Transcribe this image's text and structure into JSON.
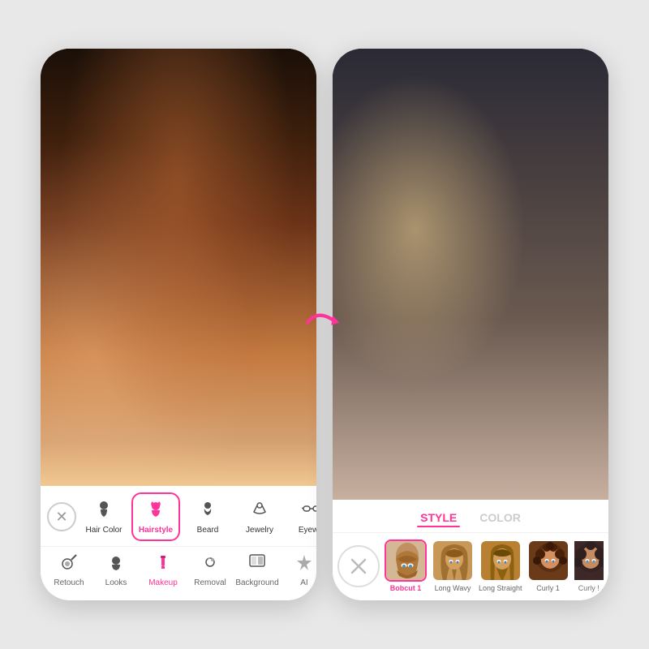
{
  "scene": {
    "background_color": "#e8e8e8"
  },
  "left_phone": {
    "toolbar": {
      "cancel_label": "×",
      "tools": [
        {
          "id": "hair-color",
          "label": "Hair Color",
          "icon": "👤",
          "active": false
        },
        {
          "id": "hairstyle",
          "label": "Hairstyle",
          "icon": "💇",
          "active": true
        },
        {
          "id": "beard",
          "label": "Beard",
          "icon": "🧔",
          "active": false
        },
        {
          "id": "jewelry",
          "label": "Jewelry",
          "icon": "💍",
          "active": false
        },
        {
          "id": "eyewear",
          "label": "Eyew...",
          "icon": "👓",
          "active": false
        }
      ],
      "bottom_tools": [
        {
          "id": "retouch",
          "label": "Retouch",
          "icon": "✨",
          "active": false
        },
        {
          "id": "looks",
          "label": "Looks",
          "icon": "🎨",
          "active": false
        },
        {
          "id": "makeup",
          "label": "Makeup",
          "icon": "💄",
          "active": true
        },
        {
          "id": "removal",
          "label": "Removal",
          "icon": "🔧",
          "active": false
        },
        {
          "id": "background",
          "label": "Background",
          "icon": "🖼",
          "active": false
        },
        {
          "id": "ai",
          "label": "AI",
          "icon": "⭐",
          "active": false
        }
      ]
    }
  },
  "right_phone": {
    "tabs": [
      {
        "id": "style",
        "label": "STYLE",
        "active": true
      },
      {
        "id": "color",
        "label": "COLOR",
        "active": false
      }
    ],
    "hairstyles": [
      {
        "id": "none",
        "label": "",
        "type": "cancel"
      },
      {
        "id": "bobcut1",
        "label": "Bobcut 1",
        "selected": true,
        "bg": "#c8a882"
      },
      {
        "id": "longwavy",
        "label": "Long Wavy",
        "selected": false,
        "bg": "#b8955a"
      },
      {
        "id": "longstraight",
        "label": "Long Straight",
        "selected": false,
        "bg": "#8b6914"
      },
      {
        "id": "curly1",
        "label": "Curly 1",
        "selected": false,
        "bg": "#3a2010"
      },
      {
        "id": "curly2",
        "label": "Curly !",
        "selected": false,
        "bg": "#1a0808"
      }
    ]
  },
  "arrow": {
    "color": "#ff3399"
  }
}
